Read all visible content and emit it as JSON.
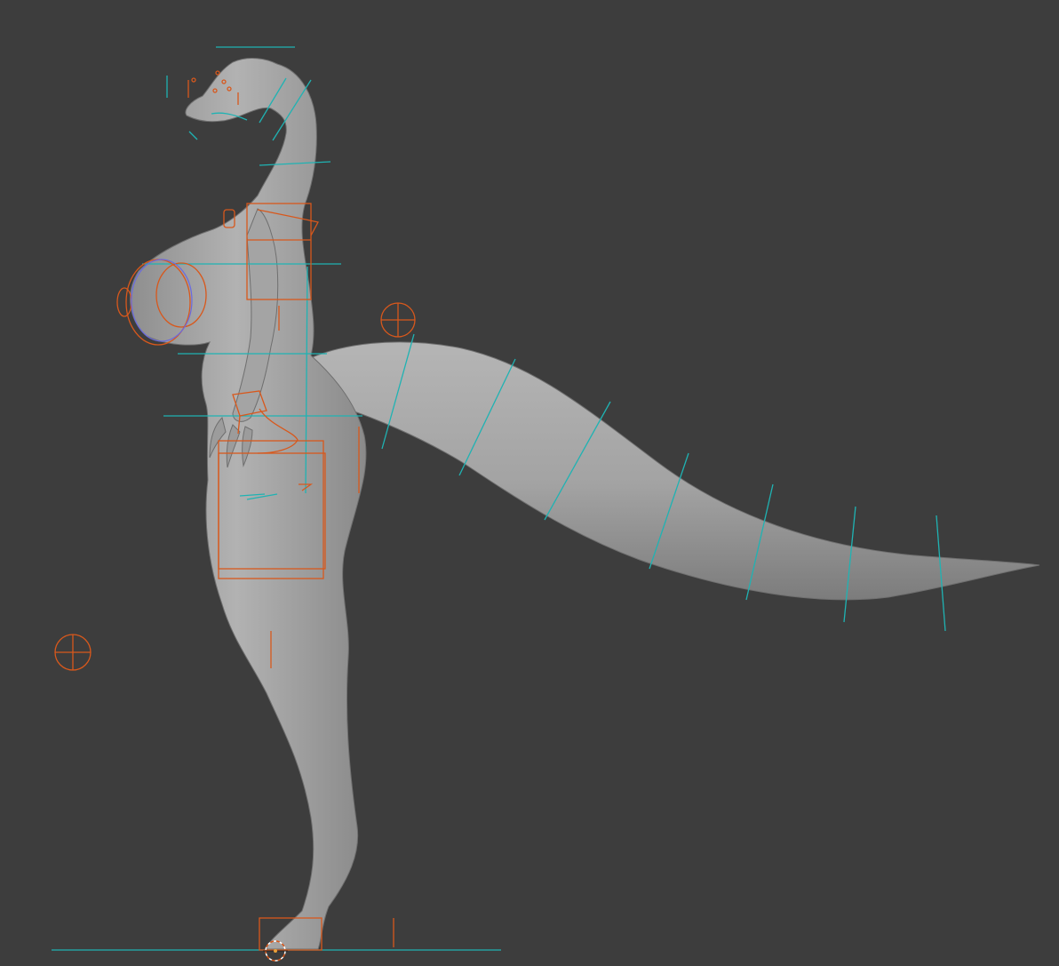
{
  "viewport": {
    "background": "#3d3d3d",
    "mesh_color": "#a9a9a9",
    "mesh_shade": "#8b8b8b",
    "bone_color": "#1fb3b3",
    "control_color": "#d8581c",
    "selection_color": "#6a6ae0"
  },
  "scene": {
    "object_type": "rigged-character-mesh",
    "gizmos": [
      "root-control-icon",
      "tail-control-icon",
      "3d-cursor-icon"
    ]
  }
}
